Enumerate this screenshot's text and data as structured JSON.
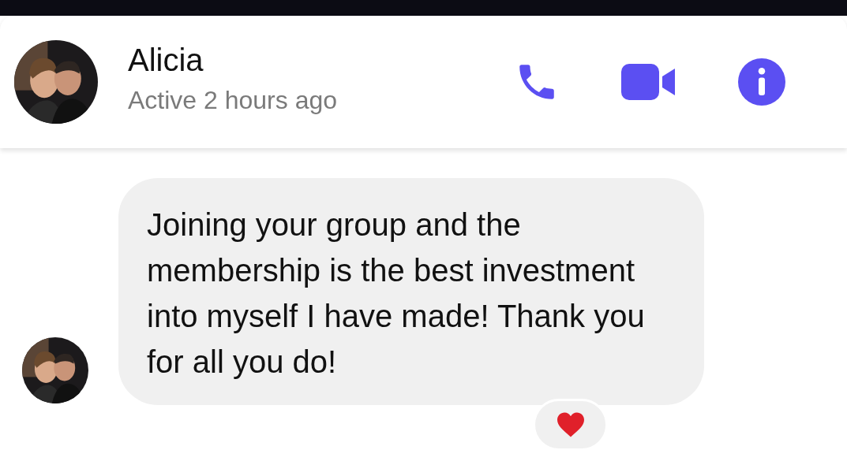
{
  "header": {
    "name": "Alicia",
    "status": "Active 2 hours ago"
  },
  "messages": [
    {
      "text": "Joining your group and the membership is the best investment into myself I have made! Thank you for all you do!",
      "reaction": {
        "kind": "heart"
      }
    }
  ]
}
